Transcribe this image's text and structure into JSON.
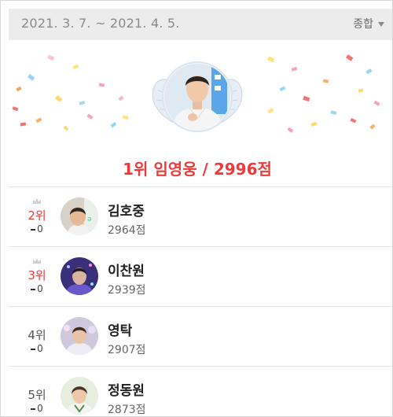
{
  "header": {
    "date_range": "2021. 3. 7. ~ 2021. 4. 5.",
    "sort_label": "종합"
  },
  "hero": {
    "rank": "1위",
    "name": "임영웅",
    "score": "2996점",
    "title": "1위 임영웅 / 2996점"
  },
  "rankings": [
    {
      "rank": "2위",
      "change": "0",
      "name": "김호중",
      "score": "2964점",
      "crown": true,
      "avatar_color": "#c7a27d"
    },
    {
      "rank": "3위",
      "change": "0",
      "name": "이찬원",
      "score": "2939점",
      "crown": true,
      "avatar_color": "#4a3f8c"
    },
    {
      "rank": "4위",
      "change": "0",
      "name": "영탁",
      "score": "2907점",
      "crown": false,
      "avatar_color": "#b6b0c8"
    },
    {
      "rank": "5위",
      "change": "0",
      "name": "정동원",
      "score": "2873점",
      "crown": false,
      "avatar_color": "#6b8c5a"
    }
  ],
  "colors": {
    "accent": "#f0393b",
    "header_bg": "#ececec"
  }
}
